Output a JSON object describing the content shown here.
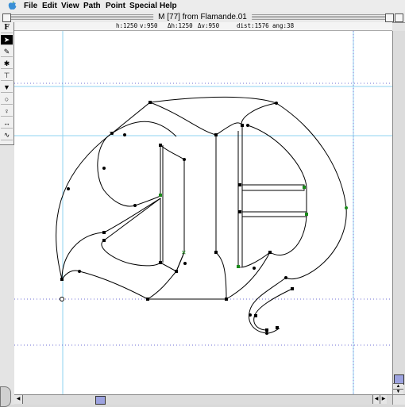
{
  "menubar": {
    "items": [
      {
        "label": "File"
      },
      {
        "label": "Edit"
      },
      {
        "label": "View"
      },
      {
        "label": "Path"
      },
      {
        "label": "Point"
      },
      {
        "label": "Special"
      },
      {
        "label": "Help"
      }
    ]
  },
  "window": {
    "title": "M [77] from Flamande.01"
  },
  "info": {
    "h": "h:1250",
    "v": "v:950",
    "dh": "Δh:1250",
    "dv": "Δv:950",
    "dist": "dist:1576",
    "ang": "ang:38"
  },
  "toolbox": {
    "tools": [
      {
        "name": "tool-f-logo",
        "glyph": "F"
      },
      {
        "name": "tool-arrow",
        "glyph": "➤"
      },
      {
        "name": "tool-pen",
        "glyph": "✎"
      },
      {
        "name": "tool-corner",
        "glyph": "✱"
      },
      {
        "name": "tool-tangent",
        "glyph": "⊤"
      },
      {
        "name": "tool-knife",
        "glyph": "▼"
      },
      {
        "name": "tool-ellipse",
        "glyph": "○"
      },
      {
        "name": "tool-measure",
        "glyph": "♀"
      },
      {
        "name": "tool-flip",
        "glyph": "↔"
      },
      {
        "name": "tool-zoom",
        "glyph": "∿"
      }
    ]
  },
  "colors": {
    "guide": "#8fd3f0",
    "metric_line": "#6f6fd6",
    "outline": "#000000",
    "tangent_point": "#1a8a1a"
  }
}
